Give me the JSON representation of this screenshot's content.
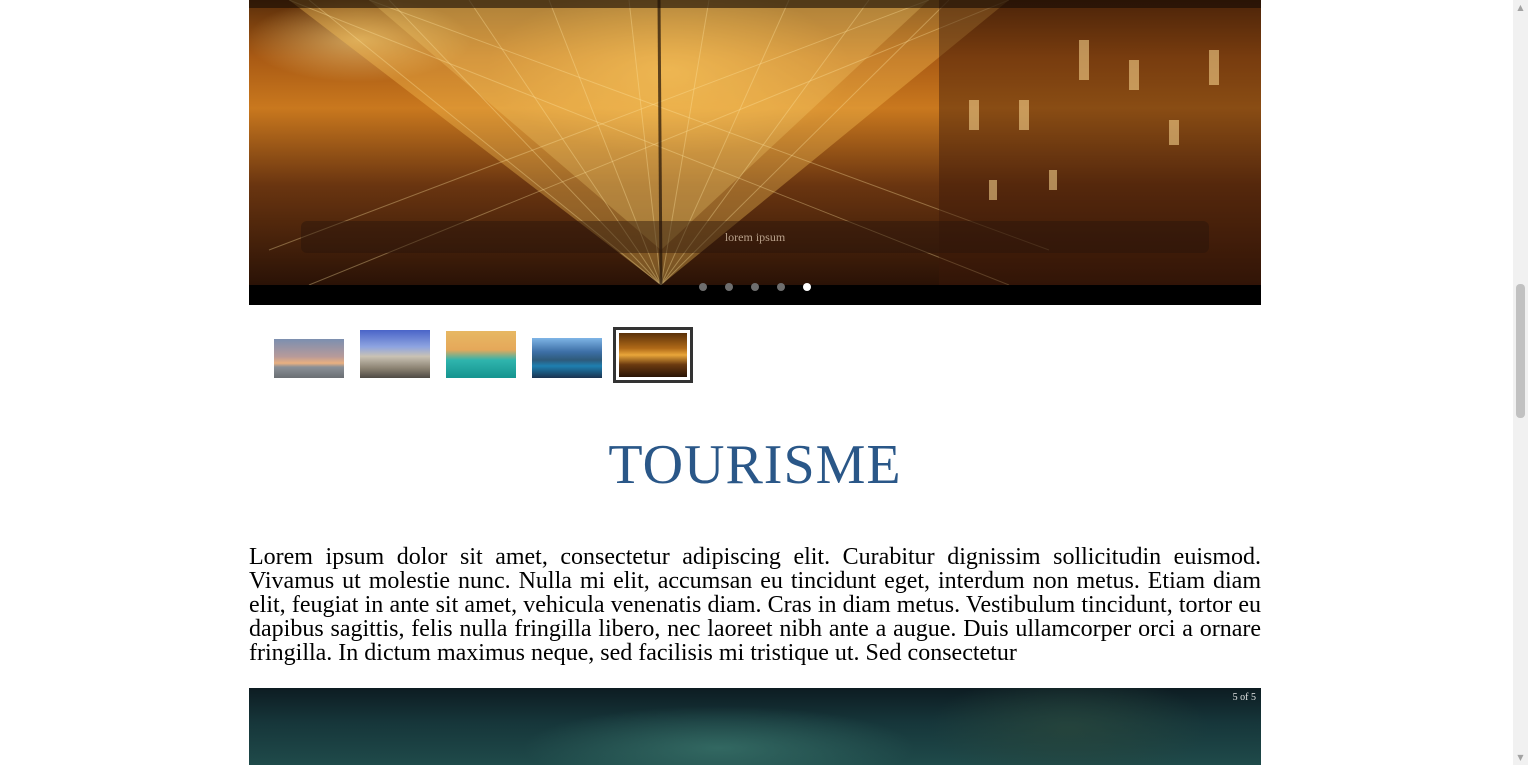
{
  "slider": {
    "caption": "lorem ipsum",
    "dots": 5,
    "active_dot": 5
  },
  "thumbnails": [
    {
      "name": "beach-sunset"
    },
    {
      "name": "cathedral"
    },
    {
      "name": "sea-coast"
    },
    {
      "name": "mountain-lake"
    },
    {
      "name": "louvre-pyramid",
      "selected": true
    }
  ],
  "section": {
    "title": "TOURISME",
    "body": "Lorem ipsum dolor sit amet, consectetur adipiscing elit. Curabitur dignissim sollicitudin euismod. Vivamus ut molestie nunc. Nulla mi elit, accumsan eu tincidunt eget, interdum non metus. Etiam diam elit, feugiat in ante sit amet, vehicula venenatis diam. Cras in diam metus. Vestibulum tincidunt, tortor eu dapibus sagittis, felis nulla fringilla libero, nec laoreet nibh ante a augue. Duis ullamcorper orci a ornare fringilla. In dictum maximus neque, sed facilisis mi tristique ut. Sed consectetur"
  },
  "slider2": {
    "counter": "5 of 5"
  },
  "colors": {
    "title": "#2a5788",
    "dot_active": "#ffffff",
    "dot_inactive": "#6e6e6e"
  }
}
